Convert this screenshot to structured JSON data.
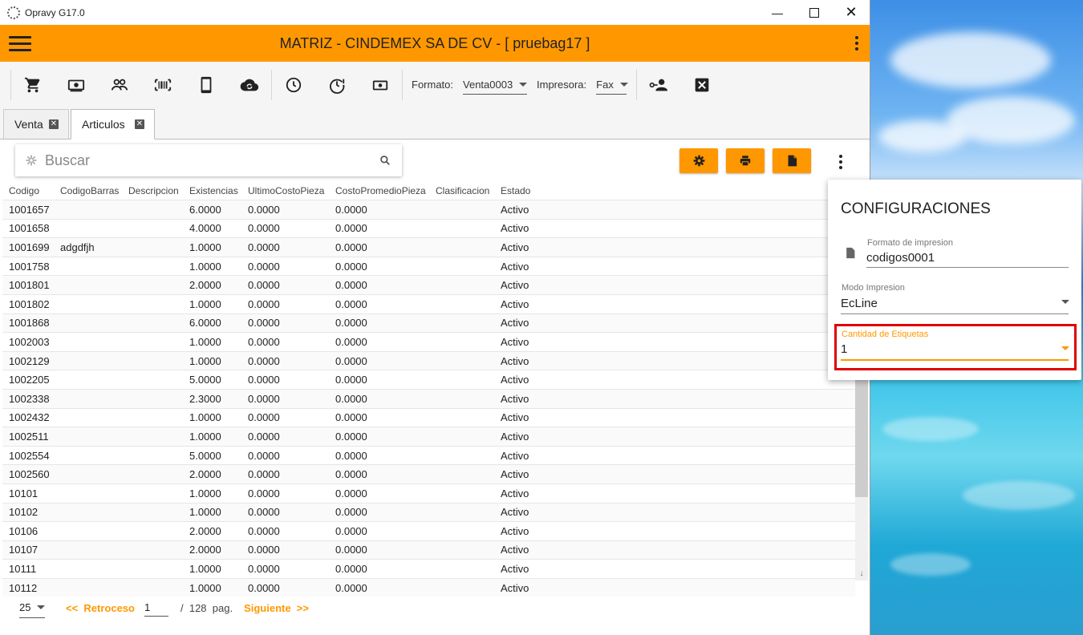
{
  "window": {
    "title": "Opravy G17.0"
  },
  "appbar": {
    "title": "MATRIZ - CINDEMEX SA DE CV - [ pruebag17 ]"
  },
  "toolbar": {
    "formato_label": "Formato:",
    "formato_value": "Venta0003",
    "impresora_label": "Impresora:",
    "impresora_value": "Fax"
  },
  "tabs": [
    {
      "label": "Venta"
    },
    {
      "label": "Articulos"
    }
  ],
  "search": {
    "placeholder": "Buscar"
  },
  "table": {
    "columns": [
      "Codigo",
      "CodigoBarras",
      "Descripcion",
      "Existencias",
      "UltimoCostoPieza",
      "CostoPromedioPieza",
      "Clasificacion",
      "Estado"
    ],
    "rows": [
      [
        "1001657",
        "",
        "",
        "6.0000",
        "0.0000",
        "0.0000",
        "",
        "Activo"
      ],
      [
        "1001658",
        "",
        "",
        "4.0000",
        "0.0000",
        "0.0000",
        "",
        "Activo"
      ],
      [
        "1001699",
        "adgdfjh",
        "",
        "1.0000",
        "0.0000",
        "0.0000",
        "",
        "Activo"
      ],
      [
        "1001758",
        "",
        "",
        "1.0000",
        "0.0000",
        "0.0000",
        "",
        "Activo"
      ],
      [
        "1001801",
        "",
        "",
        "2.0000",
        "0.0000",
        "0.0000",
        "",
        "Activo"
      ],
      [
        "1001802",
        "",
        "",
        "1.0000",
        "0.0000",
        "0.0000",
        "",
        "Activo"
      ],
      [
        "1001868",
        "",
        "",
        "6.0000",
        "0.0000",
        "0.0000",
        "",
        "Activo"
      ],
      [
        "1002003",
        "",
        "",
        "1.0000",
        "0.0000",
        "0.0000",
        "",
        "Activo"
      ],
      [
        "1002129",
        "",
        "",
        "1.0000",
        "0.0000",
        "0.0000",
        "",
        "Activo"
      ],
      [
        "1002205",
        "",
        "",
        "5.0000",
        "0.0000",
        "0.0000",
        "",
        "Activo"
      ],
      [
        "1002338",
        "",
        "",
        "2.3000",
        "0.0000",
        "0.0000",
        "",
        "Activo"
      ],
      [
        "1002432",
        "",
        "",
        "1.0000",
        "0.0000",
        "0.0000",
        "",
        "Activo"
      ],
      [
        "1002511",
        "",
        "",
        "1.0000",
        "0.0000",
        "0.0000",
        "",
        "Activo"
      ],
      [
        "1002554",
        "",
        "",
        "5.0000",
        "0.0000",
        "0.0000",
        "",
        "Activo"
      ],
      [
        "1002560",
        "",
        "",
        "2.0000",
        "0.0000",
        "0.0000",
        "",
        "Activo"
      ],
      [
        "10101",
        "",
        "",
        "1.0000",
        "0.0000",
        "0.0000",
        "",
        "Activo"
      ],
      [
        "10102",
        "",
        "",
        "1.0000",
        "0.0000",
        "0.0000",
        "",
        "Activo"
      ],
      [
        "10106",
        "",
        "",
        "2.0000",
        "0.0000",
        "0.0000",
        "",
        "Activo"
      ],
      [
        "10107",
        "",
        "",
        "2.0000",
        "0.0000",
        "0.0000",
        "",
        "Activo"
      ],
      [
        "10111",
        "",
        "",
        "1.0000",
        "0.0000",
        "0.0000",
        "",
        "Activo"
      ],
      [
        "10112",
        "",
        "",
        "1.0000",
        "0.0000",
        "0.0000",
        "",
        "Activo"
      ]
    ]
  },
  "pager": {
    "page_size": "25",
    "prev_label": "<<  Retroceso",
    "page": "1",
    "total_label": "/  128  pag.",
    "next_label": "Siguiente  >>"
  },
  "config": {
    "title": "CONFIGURACIONES",
    "formato_label": "Formato de impresion",
    "formato_value": "codigos0001",
    "modo_label": "Modo Impresion",
    "modo_value": "EcLine",
    "cantidad_label": "Cantidad de Etiquetas",
    "cantidad_value": "1"
  },
  "colors": {
    "accent": "#ff9800",
    "highlight": "#e00000"
  }
}
